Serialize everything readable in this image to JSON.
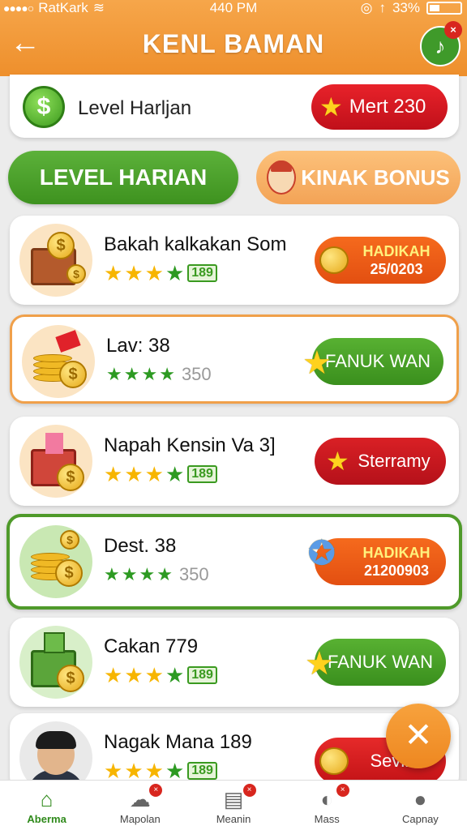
{
  "status": {
    "carrier": "RatKark",
    "time": "440 PM",
    "battery": "33%"
  },
  "header": {
    "title": "KENL BAMAN"
  },
  "top_card": {
    "label": "Level Harljan",
    "pill": "Mert 230"
  },
  "tabs": {
    "left": "LEVEL HARIAN",
    "right": "KINAK BONUS"
  },
  "levels": [
    {
      "title": "Bakah kalkakan Som",
      "tag": "189",
      "pill_l1": "HADIKAH",
      "pill_l2": "25/0203"
    },
    {
      "title": "Lav: 38",
      "count": "350",
      "pill": "FANUK WAN"
    },
    {
      "title": "Napah Kensin Va 3]",
      "tag": "189",
      "pill": "Sterramy"
    },
    {
      "title": "Dest. 38",
      "count": "350",
      "pill_l1": "HADIKAH",
      "pill_l2": "21200903"
    },
    {
      "title": "Cakan 779",
      "tag": "189",
      "pill": "FANUK WAN"
    },
    {
      "title": "Nagak Mana 189",
      "tag": "189",
      "pill": "Sevin"
    }
  ],
  "nav": [
    {
      "label": "Aberma",
      "icon": "home-icon"
    },
    {
      "label": "Mapolan",
      "icon": "chat-icon"
    },
    {
      "label": "Meanin",
      "icon": "news-icon"
    },
    {
      "label": "Mass",
      "icon": "stats-icon"
    },
    {
      "label": "Capnay",
      "icon": "user-icon"
    }
  ],
  "colors": {
    "accent": "#ee8f2c",
    "primary_green": "#3e921f",
    "alert_red": "#c0101a"
  }
}
